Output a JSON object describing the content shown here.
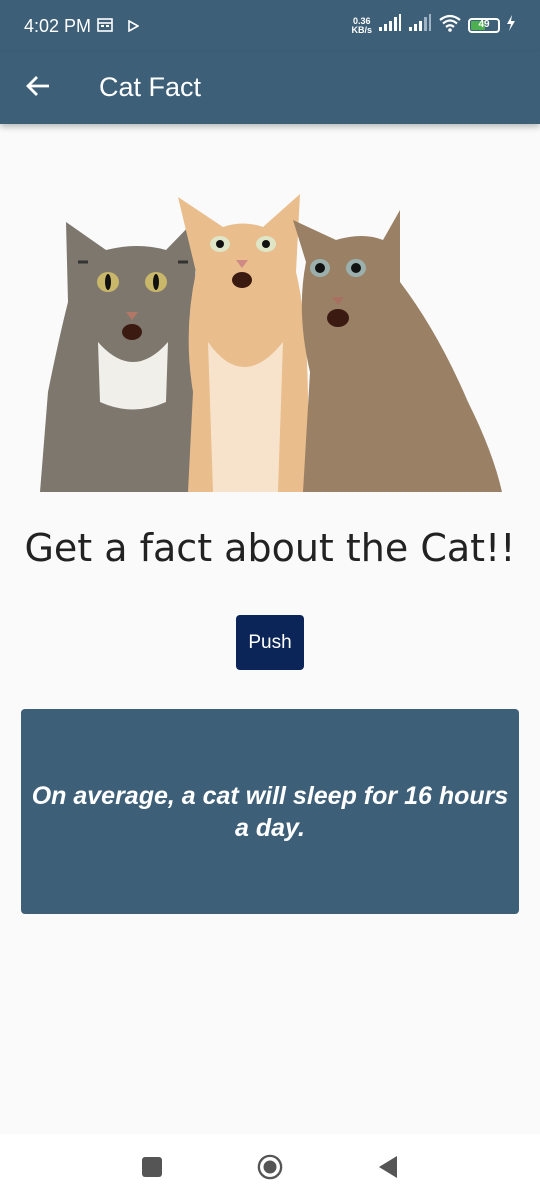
{
  "status_bar": {
    "time": "4:02 PM",
    "net_speed_value": "0.36",
    "net_speed_unit": "KB/s",
    "battery_level": "49",
    "icons": [
      "calendar-icon",
      "play-icon",
      "signal-icon",
      "signal-icon-2",
      "wifi-icon",
      "battery-icon",
      "charging-icon"
    ]
  },
  "app_bar": {
    "title": "Cat Fact",
    "back_icon": "arrow-left-icon"
  },
  "main": {
    "image_description_icon": "cats-photo",
    "headline": "Get a fact about the Cat!!",
    "push_button": "Push",
    "fact": "On average, a cat will sleep for 16 hours a day."
  },
  "nav_bar": {
    "items": [
      "recents-icon",
      "home-icon",
      "back-icon"
    ]
  },
  "colors": {
    "primary": "#3e5f78",
    "button": "#0b2559",
    "background": "#fafafa"
  }
}
